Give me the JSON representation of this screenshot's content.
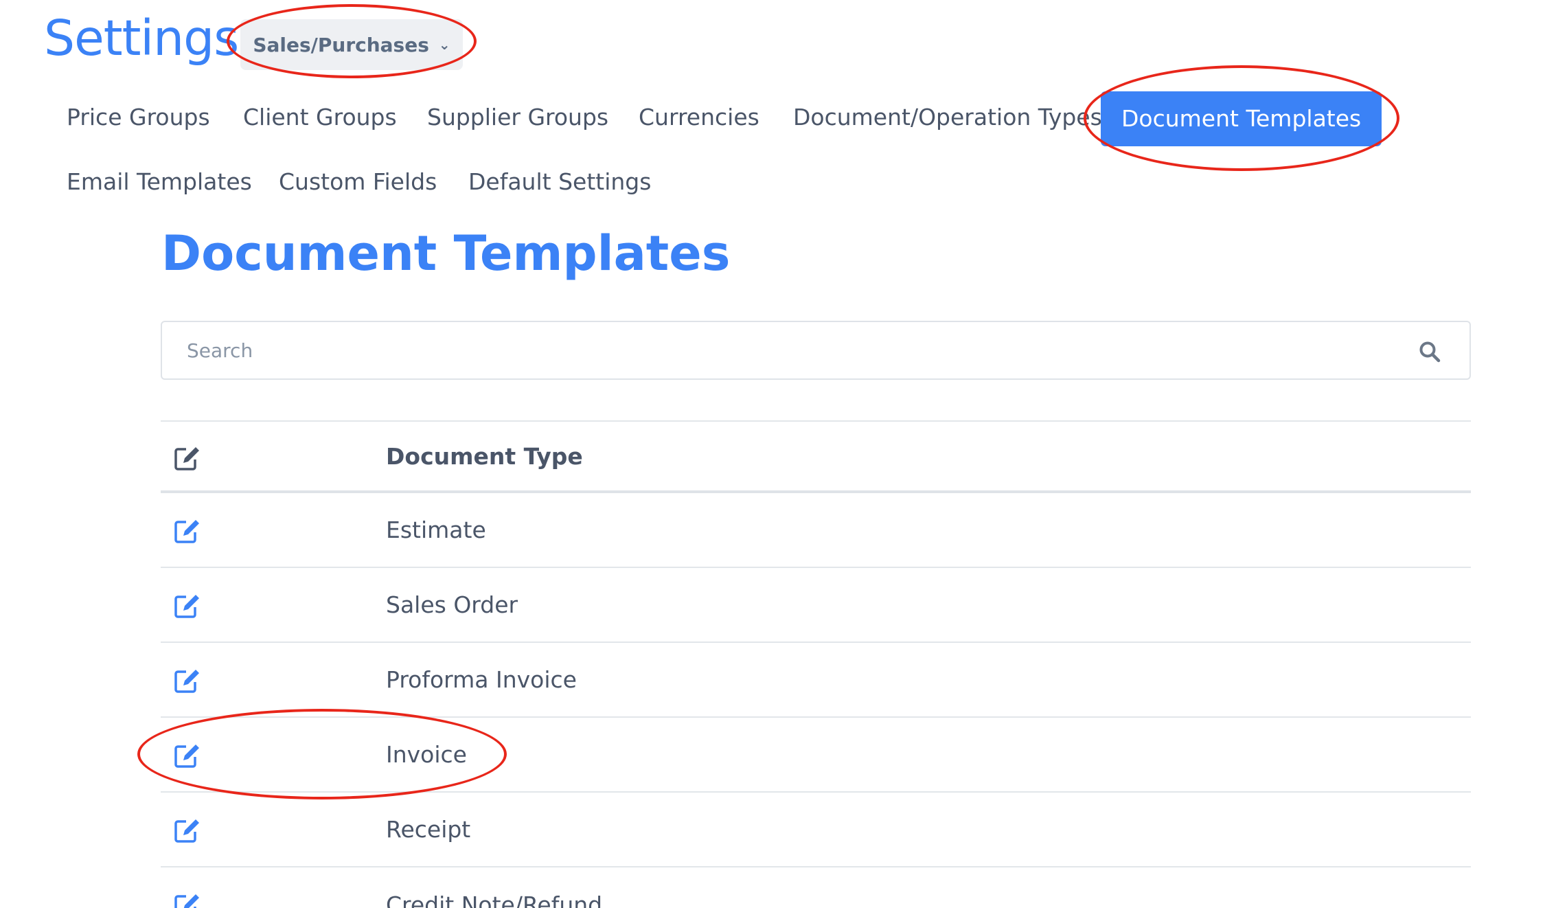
{
  "header": {
    "title": "Settings",
    "context_dropdown": {
      "selected": "Sales/Purchases",
      "icon": "chevron-down-icon"
    }
  },
  "nav": {
    "tabs": [
      {
        "label": "Price Groups"
      },
      {
        "label": "Client Groups"
      },
      {
        "label": "Supplier Groups"
      },
      {
        "label": "Currencies"
      },
      {
        "label": "Document/Operation Types"
      },
      {
        "label": "Document Templates",
        "active": true
      },
      {
        "label": "Email Templates"
      },
      {
        "label": "Custom Fields"
      },
      {
        "label": "Default Settings"
      }
    ]
  },
  "main": {
    "title": "Document Templates",
    "search": {
      "placeholder": "Search",
      "value": "",
      "icon": "search-icon"
    },
    "table": {
      "header": {
        "icon": "edit-icon",
        "column": "Document Type"
      },
      "rows": [
        {
          "label": "Estimate"
        },
        {
          "label": "Sales Order"
        },
        {
          "label": "Proforma Invoice"
        },
        {
          "label": "Invoice"
        },
        {
          "label": "Receipt"
        },
        {
          "label": "Credit Note/Refund"
        }
      ]
    }
  },
  "colors": {
    "accent": "#3b82f6",
    "text": "#4a5568",
    "annotation": "#e8261a"
  }
}
